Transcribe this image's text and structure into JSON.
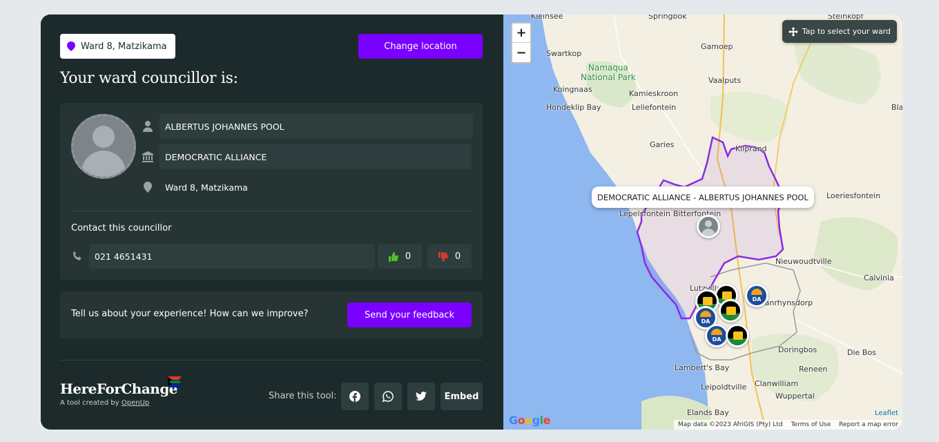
{
  "location": {
    "chip_label": "Ward 8, Matzikama",
    "change_button": "Change location"
  },
  "heading": "Your ward councillor is:",
  "councillor": {
    "name": "ALBERTUS JOHANNES POOL",
    "party": "DEMOCRATIC ALLIANCE",
    "ward": "Ward 8, Matzikama",
    "contact_label": "Contact this councillor",
    "phone": "021 4651431",
    "upvotes": "0",
    "downvotes": "0"
  },
  "feedback": {
    "prompt": "Tell us about your experience! How can we improve?",
    "button": "Send your feedback"
  },
  "footer": {
    "brand": "HereForChange",
    "tagline_prefix": "A tool created by ",
    "tagline_link": "OpenUp",
    "share_label": "Share this tool:",
    "share_icons": [
      "facebook-icon",
      "whatsapp-icon",
      "twitter-icon"
    ],
    "embed_label": "Embed"
  },
  "map": {
    "zoom_in": "+",
    "zoom_out": "−",
    "tap_hint": "Tap to select your ward",
    "tooltip": "DEMOCRATIC ALLIANCE - ALBERTUS JOHANNES POOL",
    "places": {
      "kleinsee": "Kleinsee",
      "springbok": "Springbok",
      "steinkopf": "Steinkopf",
      "swartkop": "Swartkop",
      "gamoep": "Gamoep",
      "koingnaas": "Koingnaas",
      "kamieskroon": "Kamieskroon",
      "vaalputs": "Vaalputs",
      "hondeklip": "Hondeklip Bay",
      "leliefontein": "Leliefontein",
      "garies": "Garies",
      "kliprand": "Kliprand",
      "loeriesfontein": "Loeriesfontein",
      "lepelsfontein": "Lepelsfontein",
      "bitterfontein": "Bitterfontein",
      "nieuwoudtville": "Nieuwoudtville",
      "calvinia": "Calvinia",
      "lutzville": "Lutzville",
      "vanrhynsdorp": "Vanrhynsdorp",
      "doringbos": "Doringbos",
      "diebos": "Die Bos",
      "reneen": "Reneen",
      "lamberts": "Lambert's Bay",
      "clanwilliam": "Clanwilliam",
      "leipoldtville": "Leipoldtville",
      "wuppertal": "Wuppertal",
      "elands": "Elands Bay",
      "brandvlei": "Bla"
    },
    "park_line1": "Namaqua",
    "park_line2": "National Park",
    "google": "Google",
    "leaflet": "Leaflet",
    "attribution": "Map data ©2023 AfriGIS (Pty) Ltd",
    "terms": "Terms of Use",
    "report": "Report a map error"
  },
  "colors": {
    "accent": "#7a00ff",
    "panel": "#1d2a2b",
    "ward_outline": "#8a2be2"
  }
}
